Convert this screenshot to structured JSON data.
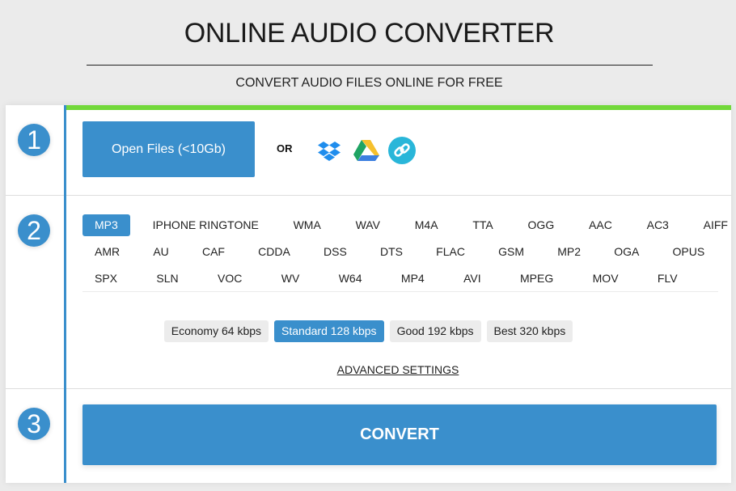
{
  "header": {
    "title": "ONLINE AUDIO CONVERTER",
    "subtitle": "CONVERT AUDIO FILES ONLINE FOR FREE"
  },
  "steps": {
    "step1": {
      "number": "1",
      "open_files_label": "Open Files (<10Gb)",
      "or_label": "OR",
      "sources": [
        {
          "name": "dropbox",
          "icon": "dropbox-icon",
          "color": "#1f8ded"
        },
        {
          "name": "google-drive",
          "icon": "google-drive-icon"
        },
        {
          "name": "url",
          "icon": "link-icon",
          "color": "#29b6d9"
        }
      ]
    },
    "step2": {
      "number": "2",
      "formats": [
        [
          "MP3",
          "IPHONE RINGTONE",
          "WMA",
          "WAV",
          "M4A",
          "TTA",
          "OGG",
          "AAC",
          "AC3",
          "AIFF"
        ],
        [
          "AMR",
          "AU",
          "CAF",
          "CDDA",
          "DSS",
          "DTS",
          "FLAC",
          "GSM",
          "MP2",
          "OGA",
          "OPUS"
        ],
        [
          "SPX",
          "SLN",
          "VOC",
          "WV",
          "W64",
          "MP4",
          "AVI",
          "MPEG",
          "MOV",
          "FLV"
        ]
      ],
      "selected_format": "MP3",
      "bitrates": [
        "Economy 64 kbps",
        "Standard 128 kbps",
        "Good 192 kbps",
        "Best 320 kbps"
      ],
      "selected_bitrate": "Standard 128 kbps",
      "advanced_label": "ADVANCED SETTINGS"
    },
    "step3": {
      "number": "3",
      "convert_label": "CONVERT"
    }
  },
  "colors": {
    "accent": "#3a8fcc",
    "progress_green": "#72d83a",
    "background": "#ebebeb"
  }
}
